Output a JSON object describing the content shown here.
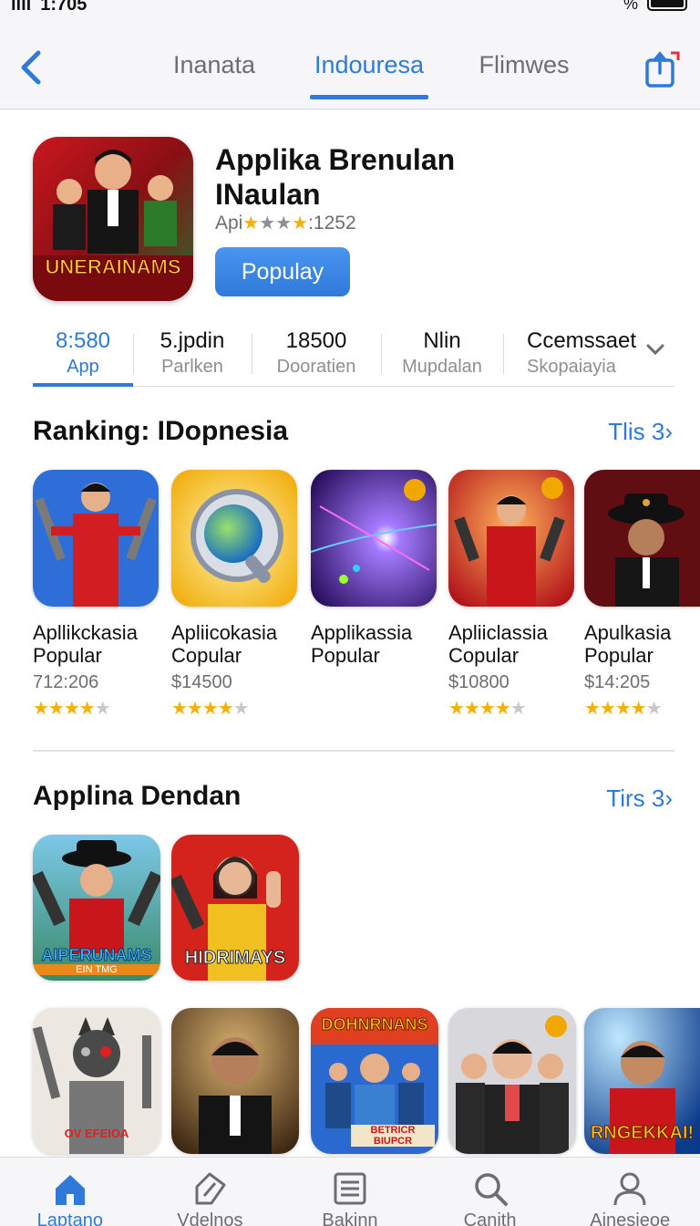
{
  "status": {
    "time": "1:705",
    "battery_label": "%"
  },
  "nav": {
    "tabs": [
      {
        "label": "Inanata",
        "active": false
      },
      {
        "label": "Indouresa",
        "active": true
      },
      {
        "label": "Flimwes",
        "active": false
      }
    ]
  },
  "app": {
    "title": "Applika Brenulan INaulan",
    "rating_prefix": "Api",
    "rating": 4,
    "rating_count": ":1252",
    "button": "Populay",
    "icon_text": "UNERAINAMS"
  },
  "stats": [
    {
      "value": "8:580",
      "label": "App",
      "active": true
    },
    {
      "value": "5.jpdin",
      "label": "Parlken",
      "active": false
    },
    {
      "value": "18500",
      "label": "Dooratien",
      "active": false
    },
    {
      "value": "Nlin",
      "label": "Mupdalan",
      "active": false
    },
    {
      "value": "Ccemssaet",
      "label": "Skopaiayia",
      "active": false
    }
  ],
  "ranking": {
    "title": "Ranking: IDopnesia",
    "more": "Tlis 3",
    "items": [
      {
        "name": "Apllikckasia Popular",
        "price": "712:206",
        "rating": 4
      },
      {
        "name": "Apliicokasia Copular",
        "price": "$14500",
        "rating": 4
      },
      {
        "name": "Applikassia Popular",
        "price": "",
        "rating": 0
      },
      {
        "name": "Apliiclassia Copular",
        "price": "$10800",
        "rating": 4
      },
      {
        "name": "Apulkasia Popular",
        "price": "$14:205",
        "rating": 4
      }
    ],
    "icon_text": "UNERAINAMS"
  },
  "section2": {
    "title": "Applina Dendan",
    "more": "Tirs 3",
    "row1": [
      {
        "text": "AIPERUNAMS",
        "sub": "EIN TMG"
      },
      {
        "text": "HIDRIMAYS",
        "sub": ""
      }
    ],
    "row2": [
      {
        "text": "OV EFEIOA",
        "sub": ""
      },
      {
        "text": "",
        "sub": ""
      },
      {
        "text": "DOHNRNANS",
        "sub": "BETRICR BIUPCR"
      },
      {
        "text": "",
        "sub": ""
      },
      {
        "text": "RNGEKKAI!",
        "sub": ""
      }
    ]
  },
  "tabbar": [
    {
      "label": "Laptano",
      "icon": "home-icon",
      "active": true
    },
    {
      "label": "Vdelnos",
      "icon": "tag-icon",
      "active": false
    },
    {
      "label": "Bakinn",
      "icon": "list-icon",
      "active": false
    },
    {
      "label": "Canith",
      "icon": "search-icon",
      "active": false
    },
    {
      "label": "Ainesieoe",
      "icon": "person-icon",
      "active": false
    }
  ],
  "colors": {
    "accent": "#2f7ad9",
    "star": "#f5b000"
  }
}
